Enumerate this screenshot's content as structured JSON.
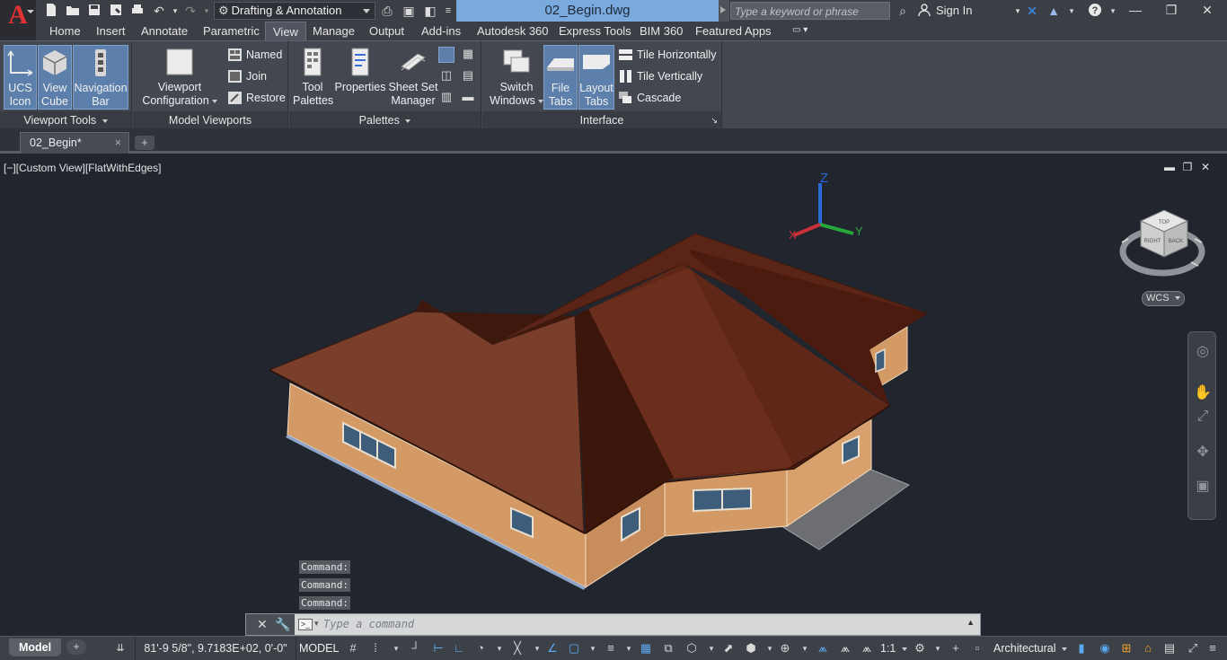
{
  "app": {
    "logo_letter": "A",
    "brand_color": "#e03232"
  },
  "titlebar": {
    "workspace": "Drafting & Annotation",
    "document": "02_Begin.dwg",
    "search_placeholder": "Type a keyword or phrase",
    "sign_in": "Sign In"
  },
  "ribbon_tabs": [
    "Home",
    "Insert",
    "Annotate",
    "Parametric",
    "View",
    "Manage",
    "Output",
    "Add-ins",
    "Autodesk 360",
    "Express Tools",
    "BIM 360",
    "Featured Apps"
  ],
  "active_tab": "View",
  "panels": {
    "viewport_tools": {
      "title": "Viewport Tools",
      "ucs_icon": [
        "UCS",
        "Icon"
      ],
      "view_cube": [
        "View",
        "Cube"
      ],
      "navigation_bar": [
        "Navigation",
        "Bar"
      ]
    },
    "model_viewports": {
      "title": "Model Viewports",
      "viewport_configuration": [
        "Viewport",
        "Configuration"
      ],
      "named": "Named",
      "join": "Join",
      "restore": "Restore"
    },
    "palettes": {
      "title": "Palettes",
      "tool_palettes": [
        "Tool",
        "Palettes"
      ],
      "properties": "Properties",
      "sheet_set_manager": [
        "Sheet Set",
        "Manager"
      ]
    },
    "interface": {
      "title": "Interface",
      "switch_windows": [
        "Switch",
        "Windows"
      ],
      "file_tabs": [
        "File",
        "Tabs"
      ],
      "layout_tabs": [
        "Layout",
        "Tabs"
      ],
      "tile_horizontally": "Tile Horizontally",
      "tile_vertically": "Tile Vertically",
      "cascade": "Cascade"
    }
  },
  "file_tab": {
    "label": "02_Begin*",
    "close": "×",
    "new": "+"
  },
  "viewport": {
    "label": "[−][Custom View][FlatWithEdges]",
    "wcs": "WCS",
    "ucs_axes": {
      "x": "X",
      "y": "Y",
      "z": "Z"
    },
    "viewcube": {
      "top": "TOP",
      "right": "RIGHT",
      "back": "BACK"
    }
  },
  "command_history": [
    "Command:",
    "Command:",
    "Command:"
  ],
  "command_line": {
    "placeholder": "Type a command"
  },
  "statusbar": {
    "model_tab": "Model",
    "coordinates": "81'-9 5/8\", 9.7183E+02, 0'-0\"",
    "space": "MODEL",
    "scale": "1:1",
    "units": "Architectural"
  },
  "colors": {
    "accent": "#7aa9de",
    "roof": "#5a2416",
    "walls": "#d49a66",
    "viewport_bg": "#21252e"
  }
}
